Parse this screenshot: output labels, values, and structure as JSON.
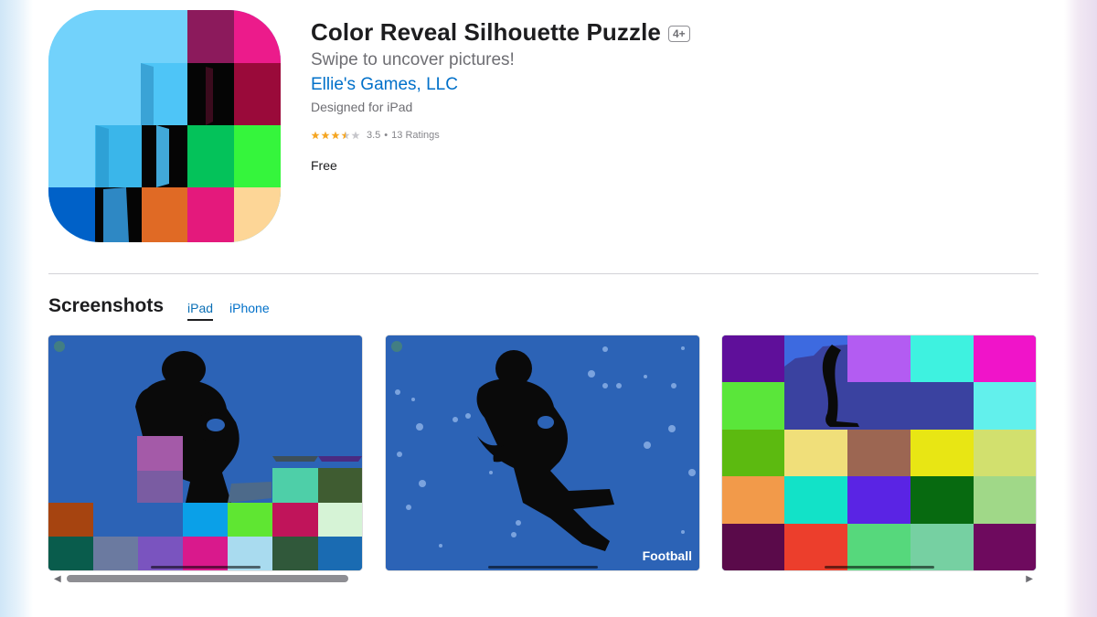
{
  "app": {
    "title": "Color Reveal Silhouette Puzzle",
    "age_rating": "4+",
    "subtitle": "Swipe to uncover pictures!",
    "developer": "Ellie's Games, LLC",
    "designed_for": "Designed for iPad",
    "rating_value": "3.5",
    "rating_separator": "•",
    "rating_count": "13 Ratings",
    "stars_filled": 3.5,
    "price": "Free"
  },
  "screenshots": {
    "heading": "Screenshots",
    "tabs": [
      {
        "label": "iPad",
        "active": true
      },
      {
        "label": "iPhone",
        "active": false
      }
    ],
    "items": [
      {
        "label": ""
      },
      {
        "label": "Football"
      },
      {
        "label": ""
      }
    ]
  },
  "scrollbar": {
    "left_icon": "scroll-left-arrow-icon",
    "right_icon": "scroll-right-arrow-icon"
  },
  "colors": {
    "link": "#0070c9",
    "star": "#f5a623",
    "screenshot_background": "#2c63b6"
  }
}
